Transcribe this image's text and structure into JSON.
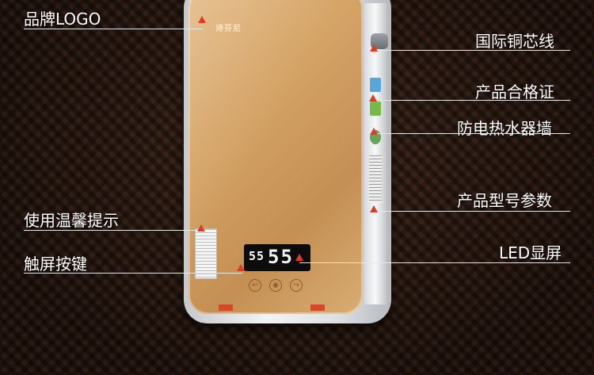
{
  "left_labels": [
    {
      "text": "品牌LOGO"
    },
    {
      "text": "使用温馨提示"
    },
    {
      "text": "触屏按键"
    }
  ],
  "right_labels": [
    {
      "text": "国际铜芯线"
    },
    {
      "text": "产品合格证"
    },
    {
      "text": "防电热水器墙"
    },
    {
      "text": "产品型号参数"
    },
    {
      "text": "LED显屏"
    }
  ],
  "product": {
    "brand_mark": "诗芬尼",
    "display_small": "55",
    "display_big": "55"
  },
  "colors": {
    "panel": "#d3a163",
    "marker": "#e23b24",
    "frame": "#e8eaec"
  },
  "icons": {
    "power_button": "power-icon",
    "mode_button": "mode-icon",
    "left_button": "swap-left-icon",
    "right_button": "swap-right-icon"
  }
}
